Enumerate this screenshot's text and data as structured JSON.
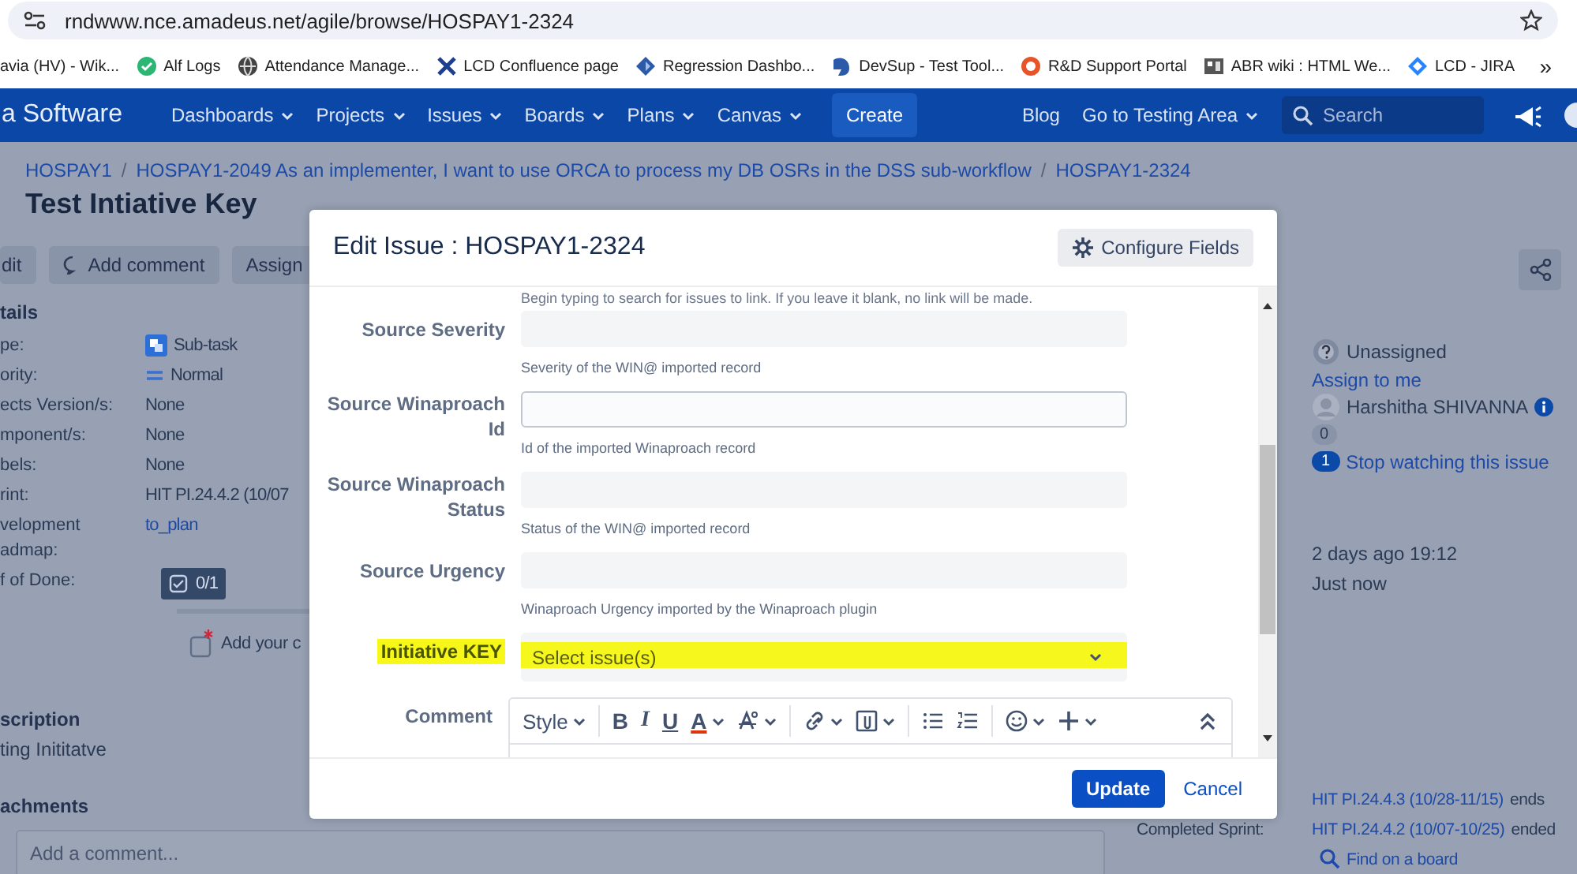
{
  "browser": {
    "address": "rndwww.nce.amadeus.net/agile/browse/HOSPAY1-2324",
    "bookmarks": [
      {
        "label": "avia (HV) - Wik..."
      },
      {
        "label": "Alf Logs"
      },
      {
        "label": "Attendance Manage..."
      },
      {
        "label": "LCD Confluence page"
      },
      {
        "label": "Regression Dashbo..."
      },
      {
        "label": "DevSup - Test Tool..."
      },
      {
        "label": "R&D Support Portal"
      },
      {
        "label": "ABR wiki : HTML We..."
      },
      {
        "label": "LCD - JIRA"
      }
    ],
    "more": "»"
  },
  "nav": {
    "logo": "a Software",
    "menus": [
      {
        "label": "Dashboards",
        "dropdown": true
      },
      {
        "label": "Projects",
        "dropdown": true
      },
      {
        "label": "Issues",
        "dropdown": true
      },
      {
        "label": "Boards",
        "dropdown": true
      },
      {
        "label": "Plans",
        "dropdown": true
      },
      {
        "label": "Canvas",
        "dropdown": true
      }
    ],
    "create": "Create",
    "blog": "Blog",
    "testing_area": "Go to Testing Area",
    "search": {
      "placeholder": "Search"
    }
  },
  "issue": {
    "breadcrumbs": [
      {
        "label": "HOSPAY1",
        "separator": "/"
      },
      {
        "label": "HOSPAY1-2049 As an implementer, I want to use ORCA to process my DB OSRs in the DSS sub-workflow",
        "separator": "/"
      },
      {
        "label": "HOSPAY1-2324"
      }
    ],
    "title": "Test Intiative Key",
    "actions": [
      {
        "label": "dit",
        "kind": "plain"
      },
      {
        "label": "Add comment",
        "kind": "comment"
      },
      {
        "label": "Assign",
        "kind": "plain"
      }
    ],
    "details_heading": "tails",
    "details": [
      {
        "label": "pe:",
        "value": "Sub-task",
        "kind": "subtask"
      },
      {
        "label": "ority:",
        "value": "Normal",
        "kind": "priority"
      },
      {
        "label": "ects Version/s:",
        "value": "None",
        "kind": "plain"
      },
      {
        "label": "mponent/s:",
        "value": "None",
        "kind": "plain"
      },
      {
        "label": "bels:",
        "value": "None",
        "kind": "plain"
      },
      {
        "label": "rint:",
        "value": "HIT PI.24.4.2 (10/07",
        "kind": "plain"
      },
      {
        "label": "velopment\nadmap:",
        "value": "to_plan",
        "kind": "link"
      },
      {
        "label": "f of Done:",
        "value": "0/1",
        "kind": "badge"
      }
    ],
    "subtask_placeholder": "Add your c",
    "description_heading": "scription",
    "description": "ting Inititatve",
    "attachments_heading": "achments",
    "comment_placeholder": "Add a comment..."
  },
  "people": {
    "assignee": "Unassigned",
    "assign_to_me": "Assign to me",
    "reporter": "Harshitha SHIVANNA",
    "votes": "0",
    "watchers": "1",
    "stop_watching": "Stop watching this issue"
  },
  "dates": [
    "2 days ago 19:12",
    "Just now"
  ],
  "sprints": [
    {
      "link": "HIT PI.24.4.3 (10/28-11/15)",
      "suffix": "ends"
    },
    {
      "label": "Completed Sprint:",
      "link": "HIT PI.24.4.2 (10/07-10/25)",
      "suffix": "ended"
    }
  ],
  "find_on_board": "Find on a board",
  "modal": {
    "title": "Edit Issue : HOSPAY1-2324",
    "configure": "Configure Fields",
    "top_hint": "Begin typing to search for issues to link. If you leave it blank, no link will be made.",
    "fields": [
      {
        "label": "Source Severity",
        "kind": "text",
        "focused": false,
        "highlighted": false,
        "hint": "Severity of the WIN@ imported record"
      },
      {
        "label": "Source Winaproach Id",
        "kind": "text",
        "focused": true,
        "highlighted": false,
        "hint": "Id of the imported Winaproach record"
      },
      {
        "label": "Source Winaproach Status",
        "kind": "text",
        "focused": false,
        "highlighted": false,
        "hint": "Status of the WIN@ imported record"
      },
      {
        "label": "Source Urgency",
        "kind": "text",
        "focused": false,
        "highlighted": false,
        "hint": "Winaproach Urgency imported by the Winaproach plugin"
      },
      {
        "label": "Initiative KEY",
        "kind": "select",
        "highlighted": true,
        "placeholder": "Select issue(s)"
      }
    ],
    "comment": {
      "label": "Comment",
      "toolbar": [
        {
          "label": "Style",
          "dropdown": true
        },
        {
          "label": "B",
          "dropdown": false
        },
        {
          "label": "I",
          "dropdown": false
        },
        {
          "label": "U",
          "dropdown": false
        },
        {
          "label": "A",
          "dropdown": true
        }
      ]
    },
    "update": "Update",
    "cancel": "Cancel"
  }
}
